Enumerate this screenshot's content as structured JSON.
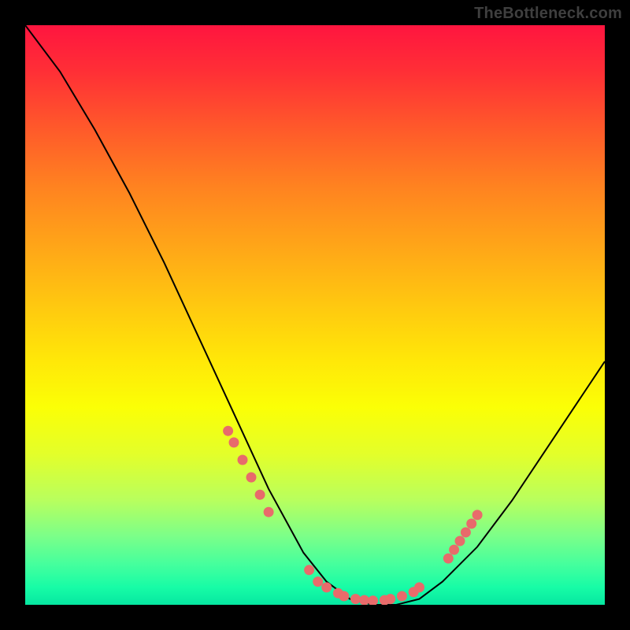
{
  "watermark": "TheBottleneck.com",
  "colors": {
    "frame_bg": "#000000",
    "marker": "#e86b6b",
    "curve": "#000000",
    "gradient_top": "#ff153f",
    "gradient_bottom": "#06e7a1"
  },
  "chart_data": {
    "type": "line",
    "title": "",
    "xlabel": "",
    "ylabel": "",
    "xlim": [
      0,
      100
    ],
    "ylim": [
      0,
      100
    ],
    "grid": false,
    "legend": false,
    "series": [
      {
        "name": "curve",
        "x": [
          0,
          6,
          12,
          18,
          24,
          30,
          36,
          42,
          48,
          52,
          56,
          60,
          64,
          68,
          72,
          78,
          84,
          90,
          96,
          100
        ],
        "y": [
          100,
          92,
          82,
          71,
          59,
          46,
          33,
          20,
          9,
          4,
          1,
          0,
          0,
          1,
          4,
          10,
          18,
          27,
          36,
          42
        ]
      }
    ],
    "markers": [
      {
        "x": 35,
        "y": 30
      },
      {
        "x": 36,
        "y": 28
      },
      {
        "x": 37.5,
        "y": 25
      },
      {
        "x": 39,
        "y": 22
      },
      {
        "x": 40.5,
        "y": 19
      },
      {
        "x": 42,
        "y": 16
      },
      {
        "x": 49,
        "y": 6
      },
      {
        "x": 50.5,
        "y": 4
      },
      {
        "x": 52,
        "y": 3
      },
      {
        "x": 54,
        "y": 2
      },
      {
        "x": 55,
        "y": 1.5
      },
      {
        "x": 57,
        "y": 1
      },
      {
        "x": 58.5,
        "y": 0.8
      },
      {
        "x": 60,
        "y": 0.7
      },
      {
        "x": 62,
        "y": 0.8
      },
      {
        "x": 63,
        "y": 1
      },
      {
        "x": 65,
        "y": 1.5
      },
      {
        "x": 67,
        "y": 2.2
      },
      {
        "x": 68,
        "y": 3
      },
      {
        "x": 73,
        "y": 8
      },
      {
        "x": 74,
        "y": 9.5
      },
      {
        "x": 75,
        "y": 11
      },
      {
        "x": 76,
        "y": 12.5
      },
      {
        "x": 77,
        "y": 14
      },
      {
        "x": 78,
        "y": 15.5
      }
    ],
    "marker_radius_px": 6
  }
}
